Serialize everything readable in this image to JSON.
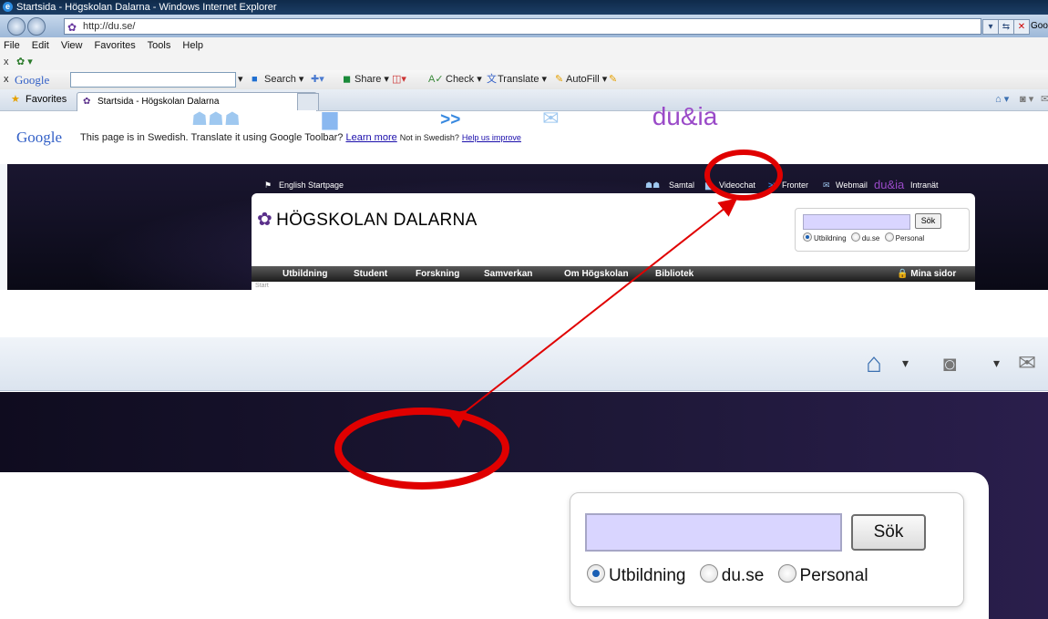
{
  "browser": {
    "title": "Startsida - Högskolan Dalarna - Windows Internet Explorer",
    "url": "http://du.se/",
    "tab_label": "Startsida - Högskolan Dalarna",
    "menu": [
      "File",
      "Edit",
      "View",
      "Favorites",
      "Tools",
      "Help"
    ],
    "favorites_label": "Favorites",
    "right_edge_label": "Goo"
  },
  "google_toolbar": {
    "logo": "Google",
    "search_label": "Search ▾",
    "share_label": "Share ▾",
    "check_label": "Check ▾",
    "translate_label": "Translate ▾",
    "autofill_label": "AutoFill ▾"
  },
  "translate_bar": {
    "logo": "Google",
    "message": "This page is in Swedish.  Translate it using Google Toolbar?",
    "learn_more": "Learn more",
    "not_in": "Not in Swedish?",
    "help": "Help us improve"
  },
  "site": {
    "english_link": "English Startpage",
    "top_links": {
      "samtal": "Samtal",
      "videochat": "Videochat",
      "fronter": "Fronter",
      "webmail": "Webmail",
      "dualia": "du&ia",
      "intranat": "Intranät"
    },
    "brand": "HÖGSKOLAN DALARNA",
    "search_button": "Sök",
    "radios": [
      "Utbildning",
      "du.se",
      "Personal"
    ],
    "nav": [
      "Utbildning",
      "Student",
      "Forskning",
      "Samverkan",
      "Om Högskolan",
      "Bibliotek"
    ],
    "mina_sidor": "Mina sidor",
    "breadcrumb": "Start"
  },
  "colors": {
    "highlight_red": "#e00000",
    "search_field": "#d9d5ff",
    "brand_purple": "#5a2f8a"
  }
}
